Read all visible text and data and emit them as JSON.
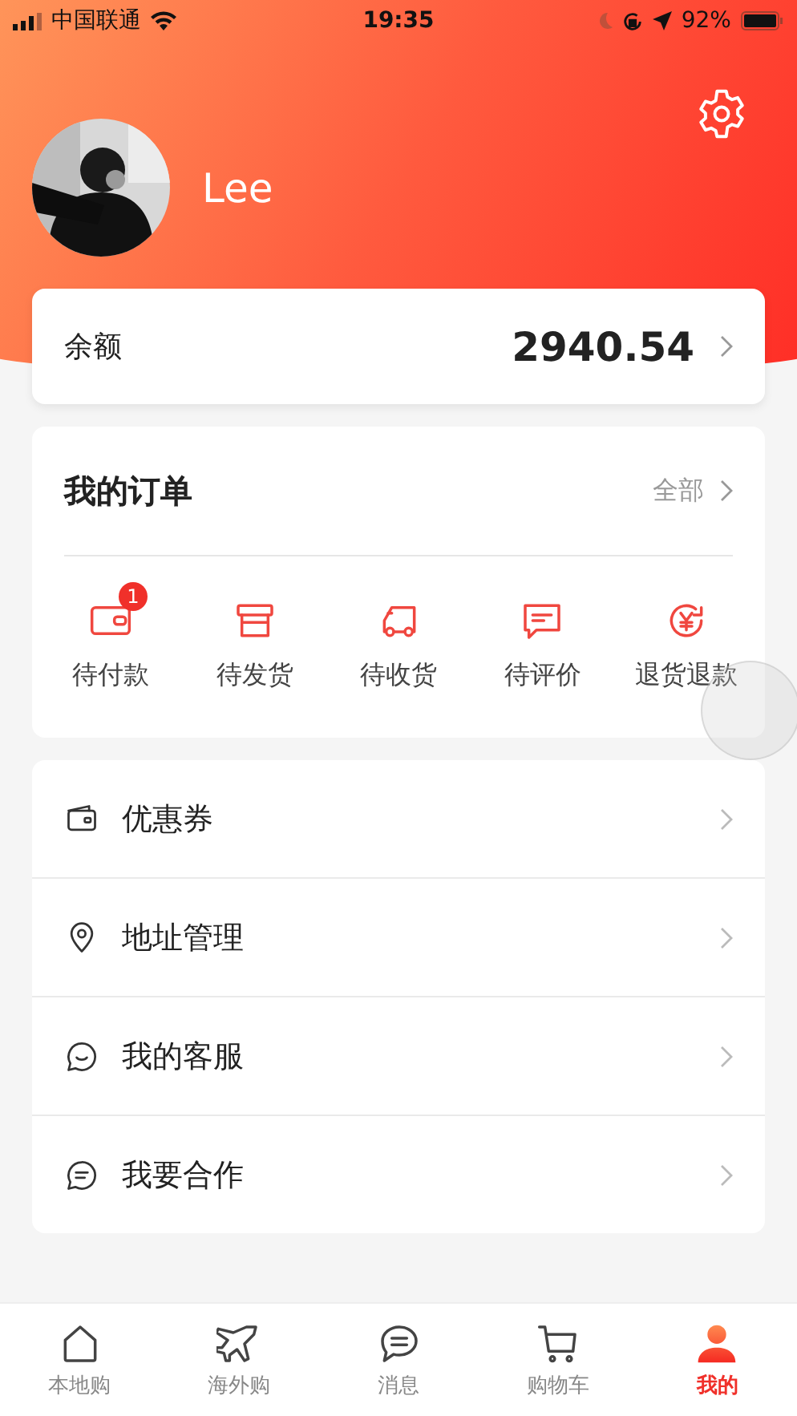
{
  "status_bar": {
    "carrier": "中国联通",
    "time": "19:35",
    "battery": "92%"
  },
  "profile": {
    "name": "Lee"
  },
  "balance": {
    "label": "余额",
    "amount": "2940.54"
  },
  "orders": {
    "title": "我的订单",
    "all_link": "全部",
    "items": [
      {
        "kind": "wallet",
        "label": "待付款",
        "badge": "1"
      },
      {
        "kind": "box",
        "label": "待发货"
      },
      {
        "kind": "truck",
        "label": "待收货"
      },
      {
        "kind": "comment",
        "label": "待评价"
      },
      {
        "kind": "refund",
        "label": "退货退款"
      }
    ]
  },
  "menu": [
    {
      "kind": "coupon",
      "label": "优惠券"
    },
    {
      "kind": "location",
      "label": "地址管理"
    },
    {
      "kind": "service",
      "label": "我的客服"
    },
    {
      "kind": "cooperate",
      "label": "我要合作"
    }
  ],
  "tab_bar": [
    {
      "kind": "home",
      "label": "本地购",
      "selected": false
    },
    {
      "kind": "plane",
      "label": "海外购",
      "selected": false
    },
    {
      "kind": "message",
      "label": "消息",
      "selected": false
    },
    {
      "kind": "cart",
      "label": "购物车",
      "selected": false
    },
    {
      "kind": "person",
      "label": "我的",
      "selected": true
    }
  ]
}
